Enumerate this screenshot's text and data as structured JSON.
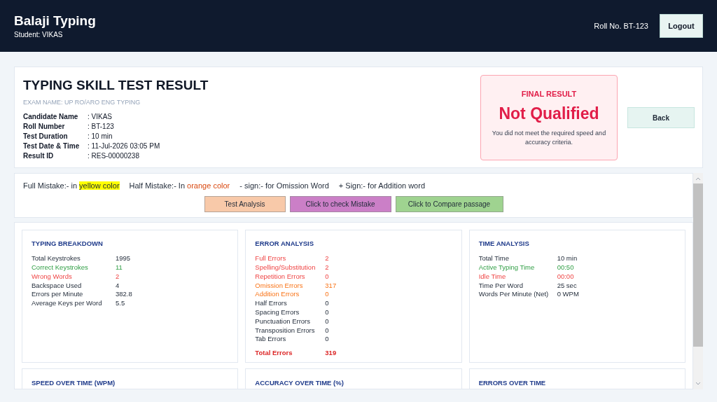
{
  "header": {
    "brand": "Balaji Typing",
    "student": "Student: VIKAS",
    "roll": "Roll No. BT-123",
    "logout": "Logout"
  },
  "result": {
    "title": "TYPING SKILL TEST RESULT",
    "exam": "EXAM NAME: UP RO/ARO ENG TYPING",
    "details": [
      {
        "label": "Candidate Name",
        "value": ": VIKAS"
      },
      {
        "label": "Roll Number",
        "value": ": BT-123"
      },
      {
        "label": "Test Duration",
        "value": ": 10 min"
      },
      {
        "label": "Test Date & Time",
        "value": ": 11-Jul-2026 03:05 PM"
      },
      {
        "label": "Result ID",
        "value": ": RES-00000238"
      }
    ],
    "final": {
      "heading": "FINAL RESULT",
      "verdict": "Not Qualified",
      "qualified": false,
      "note": "You did not meet the required speed and accuracy criteria."
    },
    "back": "Back"
  },
  "legend": [
    {
      "label": "Full Mistake:- in",
      "sample": "yellow color",
      "kind": "highlight"
    },
    {
      "label": "Half Mistake:- In",
      "sample": "orange color",
      "kind": "colored"
    },
    {
      "label": "- sign:- for Omission Word",
      "kind": "plain"
    },
    {
      "label": "+ Sign:- for Addition word",
      "kind": "plain"
    }
  ],
  "actions": [
    {
      "label": "Test Analysis",
      "color": "#f8c9a9"
    },
    {
      "label": "Click to check Mistake",
      "color": "#cb7fc7"
    },
    {
      "label": "Click to Compare passage",
      "color": "#9fd390"
    }
  ],
  "cards": [
    {
      "title": "TYPING BREAKDOWN",
      "rows": [
        {
          "label": "Total Keystrokes",
          "value": "1995",
          "kind": "plain"
        },
        {
          "label": "Correct Keystrokes",
          "value": "11",
          "kind": "good"
        },
        {
          "label": "Wrong Words",
          "value": "2",
          "kind": "bad"
        },
        {
          "label": "Backspace Used",
          "value": "4",
          "kind": "plain"
        },
        {
          "label": "Errors per Minute",
          "value": "382.8",
          "kind": "plain"
        },
        {
          "label": "Average Keys per Word",
          "value": "5.5",
          "kind": "plain"
        }
      ]
    },
    {
      "title": "ERROR ANALYSIS",
      "rows": [
        {
          "label": "Full Errors",
          "value": "2",
          "kind": "bad"
        },
        {
          "label": "Spelling/Substitution",
          "value": "2",
          "kind": "bad"
        },
        {
          "label": "Repetition Errors",
          "value": "0",
          "kind": "bad"
        },
        {
          "label": "Omission Errors",
          "value": "317",
          "kind": "warn"
        },
        {
          "label": "Addition Errors",
          "value": "0",
          "kind": "warn"
        },
        {
          "label": "Half Errors",
          "value": "0",
          "kind": "plain"
        },
        {
          "label": "Spacing Errors",
          "value": "0",
          "kind": "plain"
        },
        {
          "label": "Punctuation Errors",
          "value": "0",
          "kind": "plain"
        },
        {
          "label": "Transposition Errors",
          "value": "0",
          "kind": "plain"
        },
        {
          "label": "Tab Errors",
          "value": "0",
          "kind": "plain"
        },
        {
          "label": "Total Errors",
          "value": "319",
          "kind": "total"
        }
      ]
    },
    {
      "title": "TIME ANALYSIS",
      "rows": [
        {
          "label": "Total Time",
          "value": "10 min",
          "kind": "plain"
        },
        {
          "label": "Active Typing Time",
          "value": "00:50",
          "kind": "good"
        },
        {
          "label": "Idle Time",
          "value": "00:00",
          "kind": "bad"
        },
        {
          "label": "Time Per Word",
          "value": "25 sec",
          "kind": "plain"
        },
        {
          "label": "Words Per Minute (Net)",
          "value": "0 WPM",
          "kind": "plain"
        }
      ]
    }
  ],
  "charts": [
    {
      "title": "SPEED OVER TIME (WPM)"
    },
    {
      "title": "ACCURACY OVER TIME (%)"
    },
    {
      "title": "ERRORS OVER TIME"
    }
  ]
}
